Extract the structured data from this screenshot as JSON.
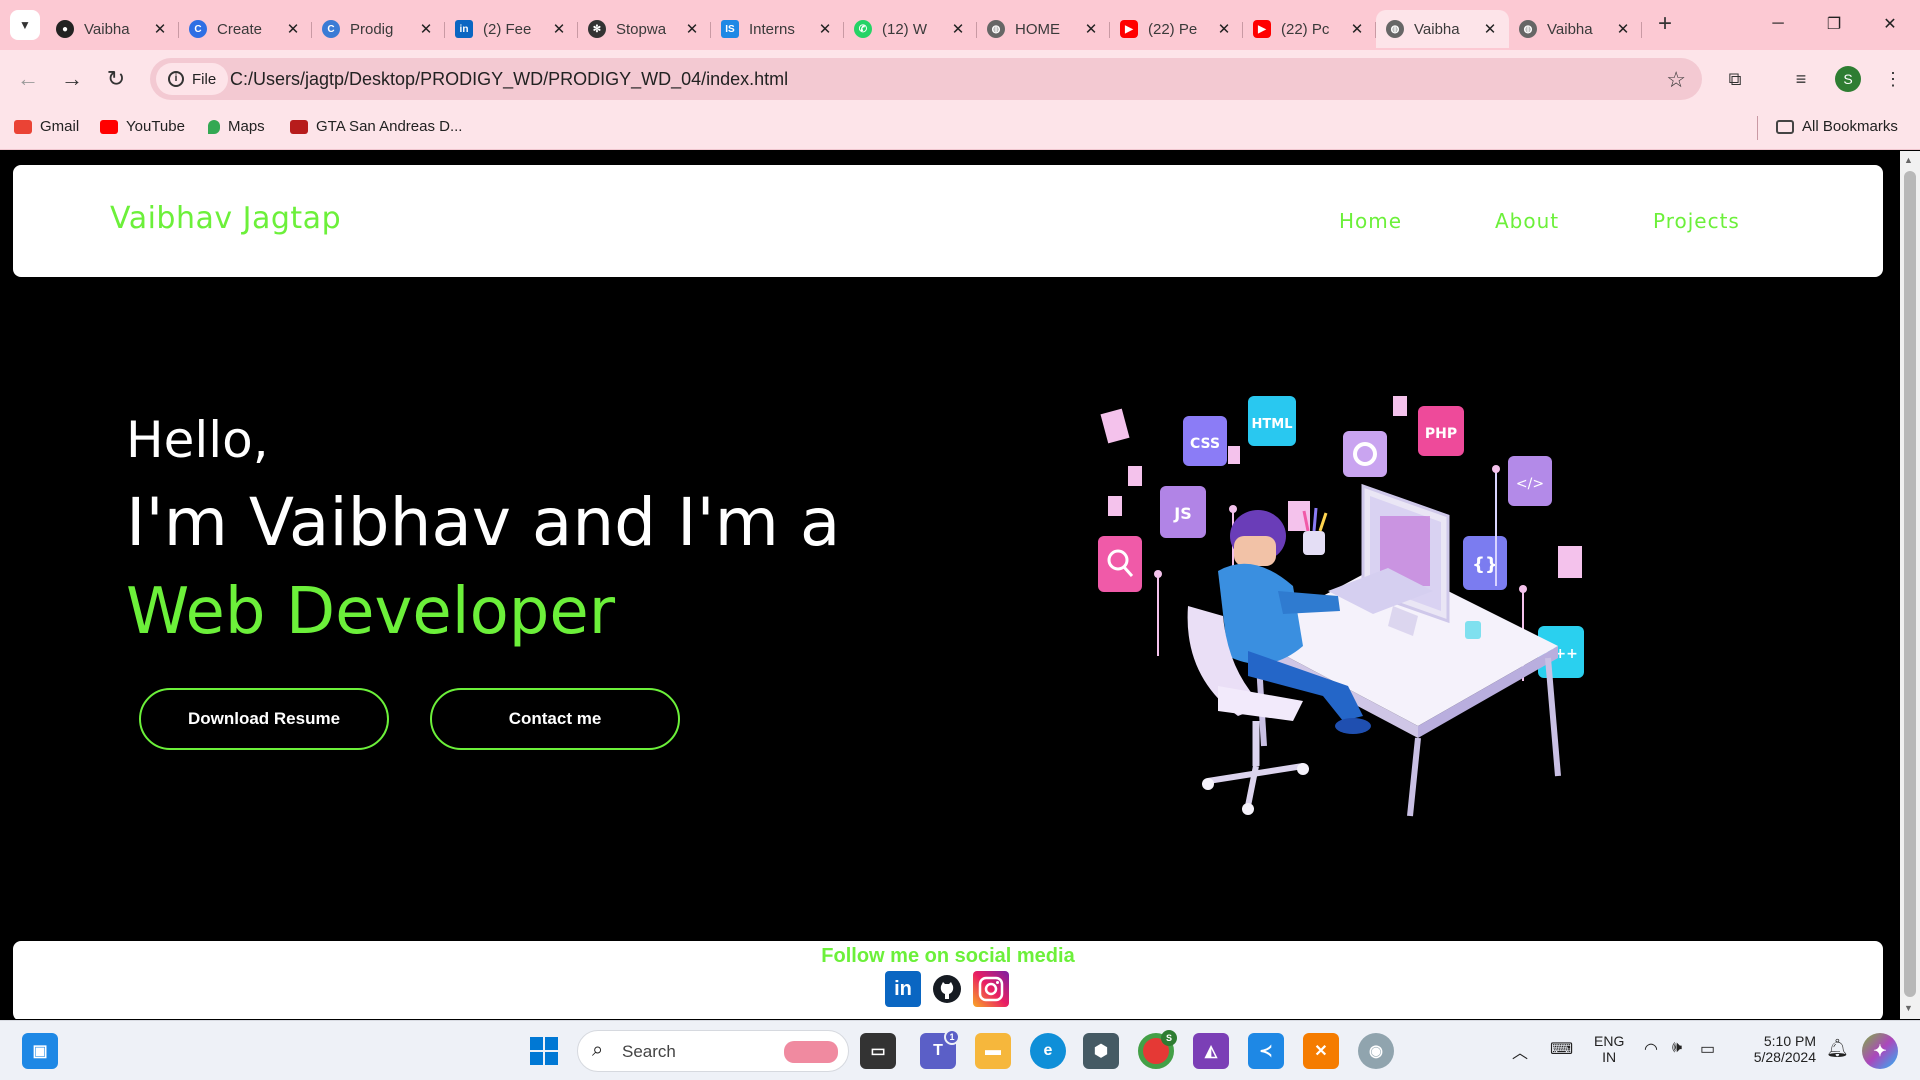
{
  "browser": {
    "tabs": [
      {
        "title": "Vaibha",
        "icon": "github-icon",
        "color": "#222222"
      },
      {
        "title": "Create",
        "icon": "canva-icon",
        "color": "#2f6fe4"
      },
      {
        "title": "Prodig",
        "icon": "circle-icon",
        "color": "#3a7bd5"
      },
      {
        "title": "(2) Fee",
        "icon": "linkedin-icon",
        "color": "#0a66c2"
      },
      {
        "title": "Stopwa",
        "icon": "openai-icon",
        "color": "#333333"
      },
      {
        "title": "Interns",
        "icon": "is-icon",
        "color": "#1e88e5"
      },
      {
        "title": "(12) W",
        "icon": "whatsapp-icon",
        "color": "#25d366"
      },
      {
        "title": "HOME",
        "icon": "globe-icon",
        "color": "#666666"
      },
      {
        "title": "(22) Pe",
        "icon": "youtube-icon",
        "color": "#ff0000"
      },
      {
        "title": "(22) Pc",
        "icon": "youtube-icon",
        "color": "#ff0000"
      },
      {
        "title": "Vaibha",
        "icon": "globe-icon",
        "color": "#666666",
        "active": true
      },
      {
        "title": "Vaibha",
        "icon": "globe-icon",
        "color": "#666666"
      }
    ],
    "file_chip": "File",
    "url": "C:/Users/jagtp/Desktop/PRODIGY_WD/PRODIGY_WD_04/index.html",
    "profile_initial": "S",
    "bookmarks": [
      {
        "label": "Gmail",
        "color": "#ea4335"
      },
      {
        "label": "YouTube",
        "color": "#ff0000"
      },
      {
        "label": "Maps",
        "color": "#34a853"
      },
      {
        "label": "GTA San Andreas D...",
        "color": "#b71c1c"
      }
    ],
    "all_bookmarks": "All Bookmarks"
  },
  "site": {
    "brand": "Vaibhav Jagtap",
    "nav": [
      "Home",
      "About",
      "Projects"
    ],
    "hero": {
      "greeting": "Hello,",
      "intro": "I'm Vaibhav and I'm a",
      "role": "Web Developer",
      "buttons": [
        "Download Resume",
        "Contact me"
      ]
    },
    "illustration_tags": [
      "CSS",
      "HTML",
      "PHP",
      "JS",
      "C++"
    ],
    "footer": {
      "follow": "Follow me on social media",
      "socials": [
        "linkedin-icon",
        "github-icon",
        "instagram-icon"
      ]
    },
    "accent_color": "#6cf03a"
  },
  "taskbar": {
    "search_label": "Search",
    "teams_badge": "1",
    "chrome_badge": "S",
    "lang": "ENG",
    "region": "IN",
    "time": "5:10 PM",
    "date": "5/28/2024"
  }
}
